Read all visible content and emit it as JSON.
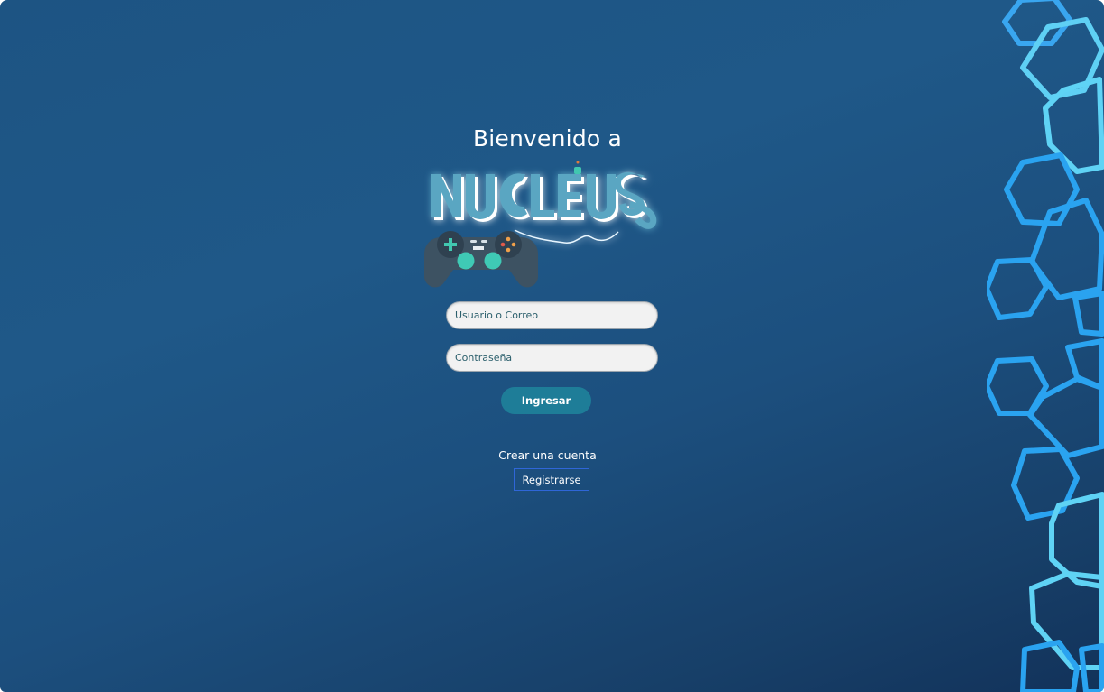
{
  "header": {
    "welcome_text": "Bienvenido a",
    "logo_alt": "NUCLEUS"
  },
  "login_form": {
    "username_placeholder": "Usuario o Correo",
    "password_placeholder": "Contraseña",
    "submit_label": "Ingresar"
  },
  "signup": {
    "prompt": "Crear una cuenta",
    "register_label": "Registrarse"
  },
  "theme": {
    "background": "#1d5483",
    "accent": "#1e7d98",
    "hex_bright": "#5fd3f5",
    "hex_blue": "#2aa3f0",
    "register_border": "#2f66d8"
  },
  "icons": [
    "gamepad-icon",
    "hexagon-pattern"
  ]
}
